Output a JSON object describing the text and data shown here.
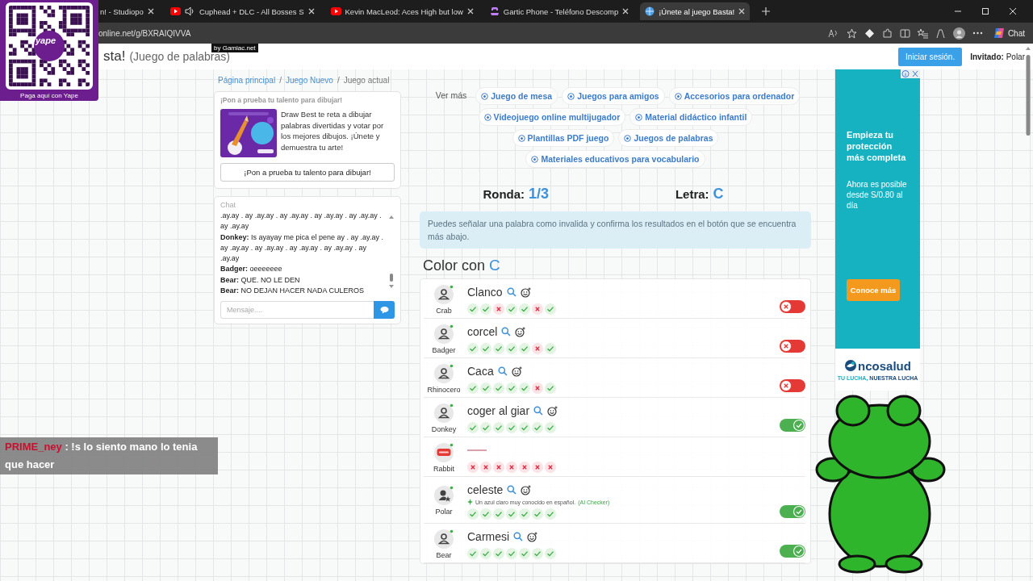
{
  "browser": {
    "tabs": [
      {
        "title": "n! - Studiopo",
        "kind": "plain",
        "audio": false,
        "selected": false
      },
      {
        "title": "Cuphead + DLC - All Bosses S",
        "kind": "video",
        "audio": true,
        "selected": false
      },
      {
        "title": "Kevin MacLeod: Aces High but low",
        "kind": "video",
        "audio": false,
        "selected": false
      },
      {
        "title": "Gartic Phone - Teléfono Descomp",
        "kind": "phone",
        "audio": false,
        "selected": false
      },
      {
        "title": "¡Únete al juego Basta!",
        "kind": "globe",
        "audio": false,
        "selected": true
      }
    ],
    "url": "online.net/g/BXRAIQIVVA",
    "chat_button": "Chat"
  },
  "qr_overlay": {
    "logo": "yape",
    "caption": "Paga aquí con Yape"
  },
  "header": {
    "badge": "by Gamiac.net",
    "title": "sta!",
    "subtitle": "(Juego de palabras)",
    "login_button": "Iniciar sesión.",
    "guest_label": "Invitado:",
    "guest_name": "Polar"
  },
  "breadcrumb": {
    "separator": "/",
    "items": [
      {
        "label": "Página principal",
        "link": true
      },
      {
        "label": "Juego Nuevo",
        "link": true
      },
      {
        "label": "Juego actual",
        "link": false
      }
    ]
  },
  "promo": {
    "heading": "¡Pon a prueba tu talento para dibujar!",
    "description": "Draw Best te reta a dibujar palabras divertidas y votar por los mejores dibujos. ¡Únete y demuestra tu arte!",
    "button": "¡Pon a prueba tu talento para dibujar!"
  },
  "chat": {
    "title": "Chat",
    "messages": [
      {
        "text": ".ay.ay . ay .ay.ay . ay .ay.ay . ay .ay.ay . ay .ay.ay . ay .ay.ay"
      },
      {
        "author": "Donkey:",
        "text": "Is ayayay me pica el pene ay . ay .ay.ay . ay .ay.ay . ay .ay.ay . ay .ay.ay . ay .ay.ay . ay .ay.ay"
      },
      {
        "author": "Badger:",
        "text": "oeeeeeee"
      },
      {
        "author": "Bear:",
        "text": "QUE. NO LE DEN"
      },
      {
        "author": "Bear:",
        "text": "NO DEJAN HACER NADA CULEROS"
      }
    ],
    "placeholder": "Mensaje...."
  },
  "related": {
    "label": "Ver más",
    "chips": [
      "Juego de mesa",
      "Juegos para amigos",
      "Accesorios para ordenador",
      "Videojuego online multijugador",
      "Material didáctico infantil",
      "Plantillas PDF juego",
      "Juegos de palabras",
      "Materiales educativos para vocabulario"
    ]
  },
  "round": {
    "label": "Ronda:",
    "value": "1/3"
  },
  "letter": {
    "label": "Letra:",
    "value": "C"
  },
  "notice": "Puedes señalar una palabra como invalida y confirma los resultados en el botón que se encuentra más abajo.",
  "category": {
    "label": "Color con",
    "letter": "C"
  },
  "answers": [
    {
      "kind": "word",
      "player": "Crab",
      "self": false,
      "word": "Clanco",
      "marks": [
        true,
        true,
        false,
        true,
        true,
        false,
        true
      ],
      "valid": false
    },
    {
      "kind": "word",
      "player": "Badger",
      "self": false,
      "word": "corcel",
      "marks": [
        true,
        true,
        true,
        true,
        true,
        false,
        true
      ],
      "valid": false
    },
    {
      "kind": "word",
      "player": "Rhinocero",
      "self": false,
      "word": "Caca",
      "marks": [
        true,
        true,
        true,
        true,
        true,
        false,
        true
      ],
      "valid": false
    },
    {
      "kind": "word",
      "player": "Donkey",
      "self": false,
      "word": "coger al giar",
      "marks": [
        true,
        true,
        true,
        true,
        true,
        true,
        true
      ],
      "valid": true
    },
    {
      "kind": "stop",
      "player": "Rabbit",
      "self": false,
      "marks": [
        false,
        false,
        false,
        false,
        false,
        false,
        false
      ]
    },
    {
      "kind": "word",
      "player": "Polar",
      "self": true,
      "word": "celeste",
      "note": "Un azul claro muy conocido en español.",
      "note_source": "(AI Checker)",
      "marks": [
        true,
        true,
        true,
        true,
        true,
        true,
        true
      ],
      "valid": true
    },
    {
      "kind": "word",
      "player": "Bear",
      "self": false,
      "word": "Carmesi",
      "marks": [
        true,
        true,
        true,
        true,
        true,
        true,
        true
      ],
      "valid": true
    }
  ],
  "ad": {
    "headline": "Empieza tu protección más completa",
    "body": "Ahora es posible desde S/0.80 al día",
    "button": "Conoce más",
    "brand": "ncosalud",
    "tagline_1": "TU LUCHA,",
    "tagline_2": "NUESTRA LUCHA"
  },
  "stream_chat": {
    "user": "PRIME_ney",
    "text": ": !s lo siento mano lo tenia que hacer"
  }
}
